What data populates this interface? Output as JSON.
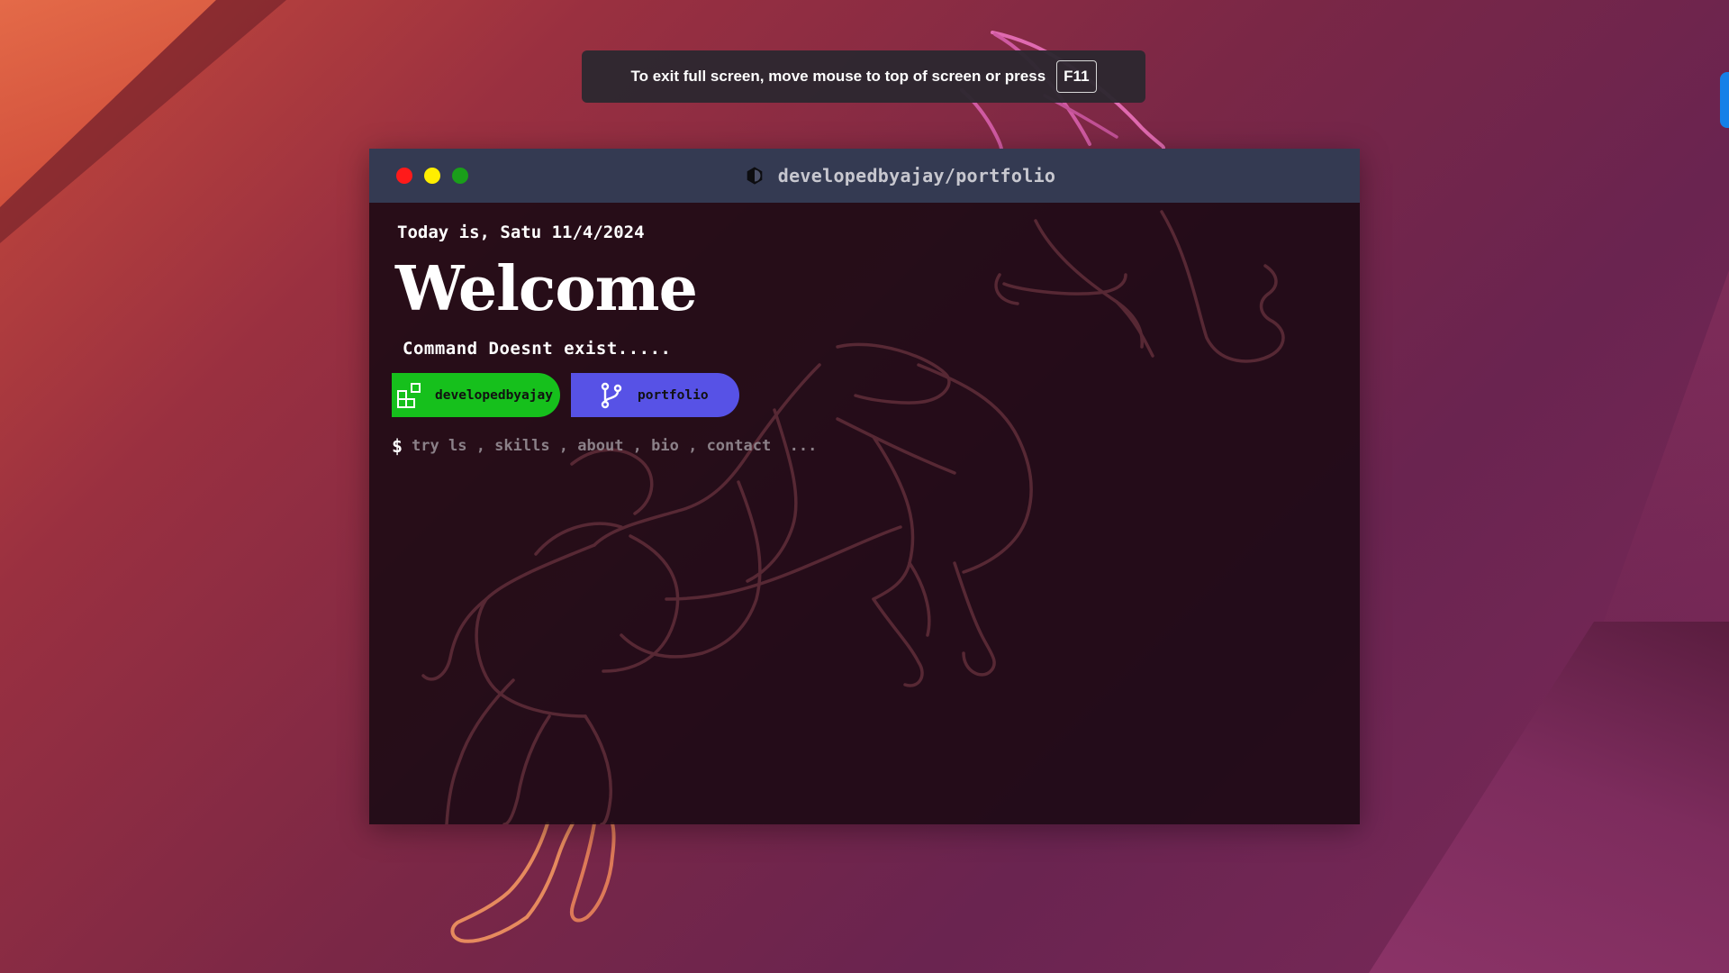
{
  "fullscreen_toast": {
    "message": "To exit full screen, move mouse to top of screen or press",
    "key": "F11"
  },
  "window": {
    "title": "developedbyajay/portfolio",
    "title_icon": "half-circle-icon",
    "controls": [
      "close",
      "minimize",
      "maximize"
    ]
  },
  "terminal": {
    "date_line": "Today is, Satu 11/4/2024",
    "welcome": "Welcome",
    "status_message": "Command Doesnt exist.....",
    "badges": [
      {
        "label": "developedbyajay",
        "icon": "apps-grid-icon",
        "color": "#16c01c"
      },
      {
        "label": "portfolio",
        "icon": "git-branch-icon",
        "color": "#5752e6"
      }
    ],
    "prompt": {
      "symbol": "$",
      "value": "",
      "placeholder": "try ls , skills , about , bio , contact  ..."
    }
  },
  "colors": {
    "title_bar": "#343a52",
    "close_dot": "#ff1a1a",
    "minimize_dot": "#ffee00",
    "maximize_dot": "#1a9e1a",
    "accent_tab": "#1580e8"
  }
}
